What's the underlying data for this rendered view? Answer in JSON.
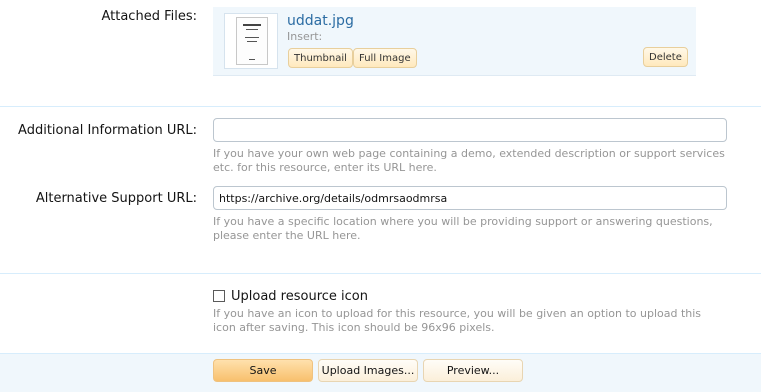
{
  "attached_files": {
    "label": "Attached Files:",
    "file": {
      "name": "uddat.jpg",
      "insert_label": "Insert:",
      "thumbnail_button": "Thumbnail",
      "full_image_button": "Full Image",
      "delete_button": "Delete"
    }
  },
  "additional_info": {
    "label": "Additional Information URL:",
    "value": "",
    "hint": "If you have your own web page containing a demo, extended description or support services etc. for this resource, enter its URL here."
  },
  "alt_support": {
    "label": "Alternative Support URL:",
    "value": "https://archive.org/details/odmrsaodmrsa",
    "hint": "If you have a specific location where you will be providing support or answering questions, please enter the URL here."
  },
  "resource_icon": {
    "label": "Upload resource icon",
    "checked": false,
    "hint": "If you have an icon to upload for this resource, you will be given an option to upload this icon after saving. This icon should be 96x96 pixels."
  },
  "footer": {
    "save_button": "Save",
    "upload_images_button": "Upload Images...",
    "preview_button": "Preview..."
  }
}
